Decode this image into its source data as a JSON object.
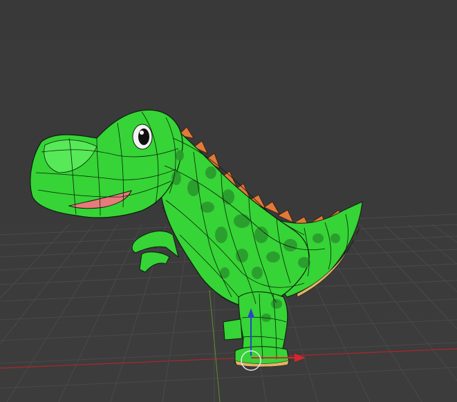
{
  "viewport": {
    "background": "#3a3a3a",
    "grid_color": "#4a4a4a",
    "x_axis_color": "#b0262b",
    "y_axis_color": "#5f8f2c"
  },
  "model": {
    "body_color": "#36d436",
    "body_highlight": "#57e957",
    "spot_color": "#2a9a2e",
    "spine_color": "#e07a3a",
    "belly_color": "#e8b06a",
    "mouth_color": "#e77a7a",
    "wire_color": "#0c1e0c"
  },
  "gizmo": {
    "z_arrow_color": "#2c43c8",
    "x_arrow_color": "#d9252a",
    "pivot_circle_color": "#e8e8e8"
  }
}
